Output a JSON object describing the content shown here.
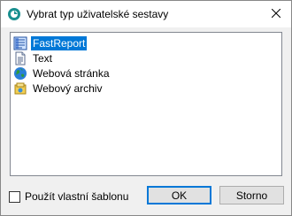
{
  "window": {
    "title": "Vybrat typ uživatelské sestavy",
    "app_icon": "fastreport-app-icon",
    "close_icon": "close-icon"
  },
  "list": {
    "items": [
      {
        "label": "FastReport",
        "icon": "fastreport-icon",
        "selected": true
      },
      {
        "label": "Text",
        "icon": "text-document-icon",
        "selected": false
      },
      {
        "label": "Webová stránka",
        "icon": "globe-icon",
        "selected": false
      },
      {
        "label": "Webový archiv",
        "icon": "web-archive-icon",
        "selected": false
      }
    ]
  },
  "footer": {
    "checkbox_label": "Použít vlastní šablonu",
    "checkbox_checked": false,
    "ok_label": "OK",
    "cancel_label": "Storno"
  },
  "colors": {
    "selection": "#0078d7",
    "default_button_border": "#0078d7"
  }
}
